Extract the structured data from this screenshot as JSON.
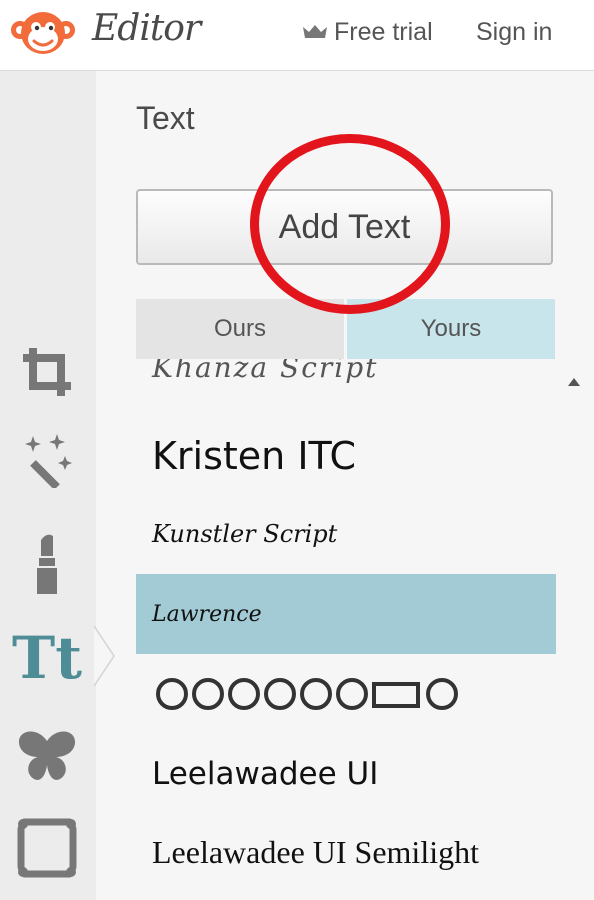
{
  "header": {
    "brand": "Editor",
    "free_trial_label": "Free trial",
    "sign_in_label": "Sign in"
  },
  "sidebar": {
    "tools": [
      {
        "name": "crop-icon"
      },
      {
        "name": "magic-wand-icon"
      },
      {
        "name": "lipstick-icon"
      },
      {
        "name": "text-tool-icon",
        "label": "Tt",
        "active": true
      },
      {
        "name": "butterfly-icon"
      },
      {
        "name": "frame-icon"
      }
    ]
  },
  "panel": {
    "title": "Text",
    "add_text_label": "Add Text",
    "tabs": [
      {
        "label": "Ours",
        "active": false
      },
      {
        "label": "Yours",
        "active": true
      }
    ],
    "fonts": [
      {
        "label": "Khanza Script"
      },
      {
        "label": "Kristen ITC"
      },
      {
        "label": "Kunstler Script"
      },
      {
        "label": "Lawrence",
        "selected": true
      },
      {
        "label": "ornament-font-preview"
      },
      {
        "label": "Leelawadee UI"
      },
      {
        "label": "Leelawadee UI Semilight"
      }
    ]
  },
  "colors": {
    "accent": "#4e8c96",
    "selected_row": "#a3cbd5",
    "yours_tab": "#c9e5ec",
    "annotation": "#e3151c"
  }
}
